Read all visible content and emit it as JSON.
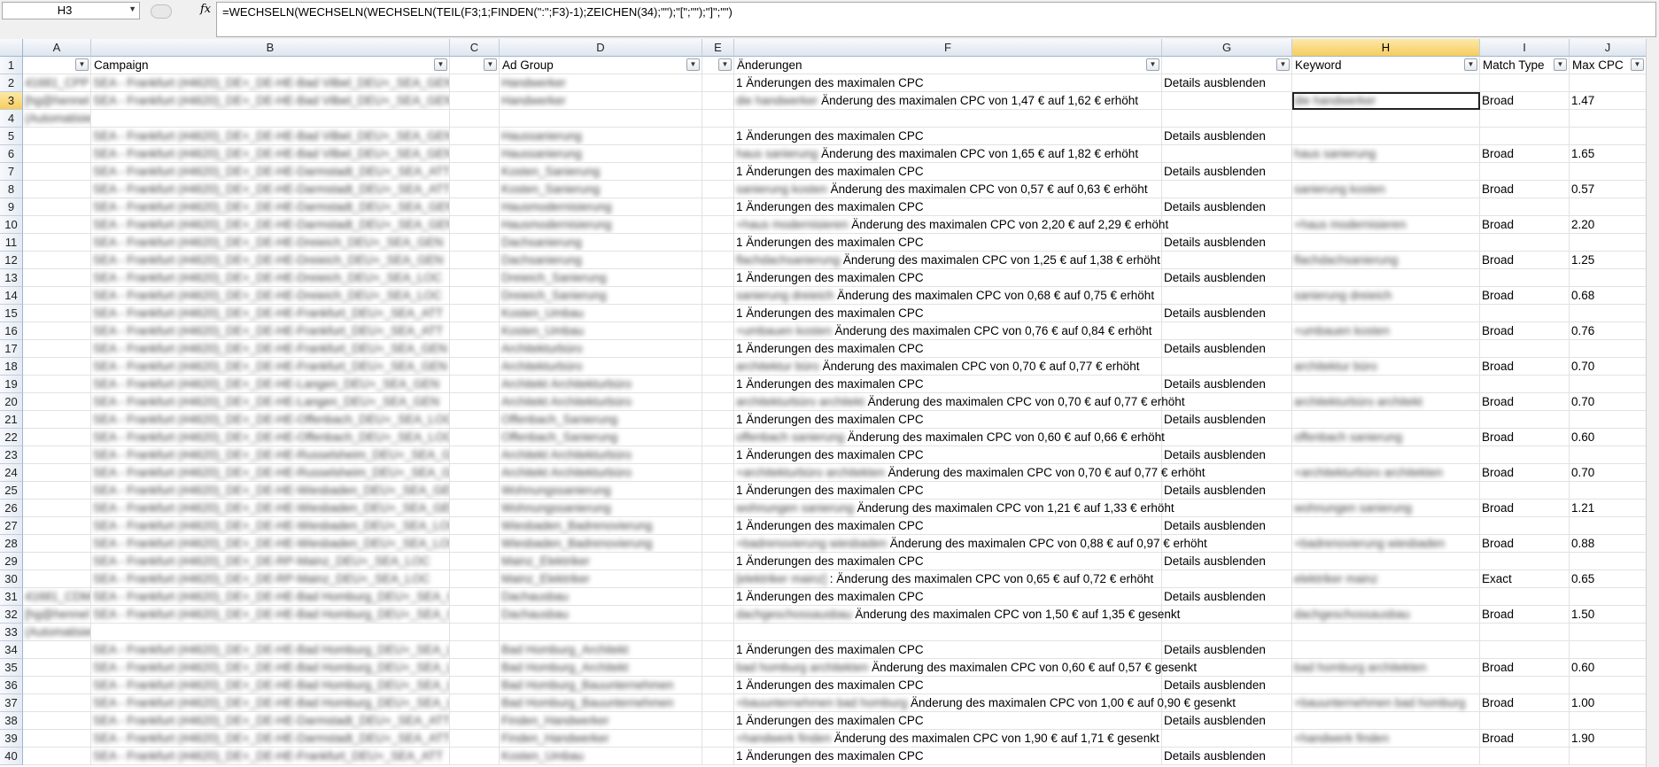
{
  "formula_bar": {
    "name_box": "H3",
    "fx": "fx",
    "formula": "=WECHSELN(WECHSELN(WECHSELN(TEIL(F3;1;FINDEN(\":\";F3)-1);ZEICHEN(34);\"\");\"[\";\"\");\"]\";\"\")"
  },
  "columns": [
    "A",
    "B",
    "C",
    "D",
    "E",
    "F",
    "G",
    "H",
    "I",
    "J"
  ],
  "headers": {
    "A": "",
    "B": "Campaign",
    "C": "",
    "D": "Ad Group",
    "E": "",
    "F": "Änderungen",
    "G": "",
    "H": "Keyword",
    "I": "Match Type",
    "J": "Max CPC"
  },
  "rows": [
    {
      "n": "2",
      "a": "41681_CPP",
      "b": "SEA - Frankfurt (#4620)_DE+_DE-HE-Bad Vilbel_DEU+_SEA_GEN",
      "d": "Handwerker",
      "f_pre": "",
      "f": "1 Änderungen des maximalen CPC",
      "g": "Details ausblenden",
      "h": "",
      "i": "",
      "j": ""
    },
    {
      "n": "3",
      "a": "[hg@hennel",
      "b": "SEA - Frankfurt (#4620)_DE+_DE-HE-Bad Vilbel_DEU+_SEA_GEN",
      "d": "Handwerker",
      "f_pre": "die handwerker",
      "f": "Änderung des maximalen CPC von 1,47 € auf 1,62 € erhöht",
      "g": "",
      "h": "die handwerker",
      "i": "Broad",
      "j": "1.47"
    },
    {
      "n": "4",
      "a": "(Automatisierung)",
      "b": "",
      "d": "",
      "f_pre": "",
      "f": "",
      "g": "",
      "h": "",
      "i": "",
      "j": ""
    },
    {
      "n": "5",
      "a": "",
      "b": "SEA - Frankfurt (#4620)_DE+_DE-HE-Bad Vilbel_DEU+_SEA_GEN",
      "d": "Haussanierung",
      "f_pre": "",
      "f": "1 Änderungen des maximalen CPC",
      "g": "Details ausblenden",
      "h": "",
      "i": "",
      "j": ""
    },
    {
      "n": "6",
      "a": "",
      "b": "SEA - Frankfurt (#4620)_DE+_DE-HE-Bad Vilbel_DEU+_SEA_GEN",
      "d": "Haussanierung",
      "f_pre": "haus sanierung",
      "f": "Änderung des maximalen CPC von 1,65 € auf 1,82 € erhöht",
      "g": "",
      "h": "haus sanierung",
      "i": "Broad",
      "j": "1.65"
    },
    {
      "n": "7",
      "a": "",
      "b": "SEA - Frankfurt (#4620)_DE+_DE-HE-Darmstadt_DEU+_SEA_ATT",
      "d": "Kosten_Sanierung",
      "f_pre": "",
      "f": "1 Änderungen des maximalen CPC",
      "g": "Details ausblenden",
      "h": "",
      "i": "",
      "j": ""
    },
    {
      "n": "8",
      "a": "",
      "b": "SEA - Frankfurt (#4620)_DE+_DE-HE-Darmstadt_DEU+_SEA_ATT",
      "d": "Kosten_Sanierung",
      "f_pre": "sanierung kosten",
      "f": "Änderung des maximalen CPC von 0,57 € auf 0,63 € erhöht",
      "g": "",
      "h": "sanierung kosten",
      "i": "Broad",
      "j": "0.57"
    },
    {
      "n": "9",
      "a": "",
      "b": "SEA - Frankfurt (#4620)_DE+_DE-HE-Darmstadt_DEU+_SEA_GEN",
      "d": "Hausmodernisierung",
      "f_pre": "",
      "f": "1 Änderungen des maximalen CPC",
      "g": "Details ausblenden",
      "h": "",
      "i": "",
      "j": ""
    },
    {
      "n": "10",
      "a": "",
      "b": "SEA - Frankfurt (#4620)_DE+_DE-HE-Darmstadt_DEU+_SEA_GEN",
      "d": "Hausmodernisierung",
      "f_pre": "+haus modernisieren",
      "f": "Änderung des maximalen CPC von 2,20 € auf 2,29 € erhöht",
      "g": "",
      "h": "+haus modernisieren",
      "i": "Broad",
      "j": "2.20"
    },
    {
      "n": "11",
      "a": "",
      "b": "SEA - Frankfurt (#4620)_DE+_DE-HE-Dreieich_DEU+_SEA_GEN",
      "d": "Dachsanierung",
      "f_pre": "",
      "f": "1 Änderungen des maximalen CPC",
      "g": "Details ausblenden",
      "h": "",
      "i": "",
      "j": ""
    },
    {
      "n": "12",
      "a": "",
      "b": "SEA - Frankfurt (#4620)_DE+_DE-HE-Dreieich_DEU+_SEA_GEN",
      "d": "Dachsanierung",
      "f_pre": "flachdachsanierung",
      "f": "Änderung des maximalen CPC von 1,25 € auf 1,38 € erhöht",
      "g": "",
      "h": "flachdachsanierung",
      "i": "Broad",
      "j": "1.25"
    },
    {
      "n": "13",
      "a": "",
      "b": "SEA - Frankfurt (#4620)_DE+_DE-HE-Dreieich_DEU+_SEA_LOC",
      "d": "Dreieich_Sanierung",
      "f_pre": "",
      "f": "1 Änderungen des maximalen CPC",
      "g": "Details ausblenden",
      "h": "",
      "i": "",
      "j": ""
    },
    {
      "n": "14",
      "a": "",
      "b": "SEA - Frankfurt (#4620)_DE+_DE-HE-Dreieich_DEU+_SEA_LOC",
      "d": "Dreieich_Sanierung",
      "f_pre": "sanierung dreieich",
      "f": "Änderung des maximalen CPC von 0,68 € auf 0,75 € erhöht",
      "g": "",
      "h": "sanierung dreieich",
      "i": "Broad",
      "j": "0.68"
    },
    {
      "n": "15",
      "a": "",
      "b": "SEA - Frankfurt (#4620)_DE+_DE-HE-Frankfurt_DEU+_SEA_ATT",
      "d": "Kosten_Umbau",
      "f_pre": "",
      "f": "1 Änderungen des maximalen CPC",
      "g": "Details ausblenden",
      "h": "",
      "i": "",
      "j": ""
    },
    {
      "n": "16",
      "a": "",
      "b": "SEA - Frankfurt (#4620)_DE+_DE-HE-Frankfurt_DEU+_SEA_ATT",
      "d": "Kosten_Umbau",
      "f_pre": "+umbauen kosten",
      "f": "Änderung des maximalen CPC von 0,76 € auf 0,84 € erhöht",
      "g": "",
      "h": "+umbauen kosten",
      "i": "Broad",
      "j": "0.76"
    },
    {
      "n": "17",
      "a": "",
      "b": "SEA - Frankfurt (#4620)_DE+_DE-HE-Frankfurt_DEU+_SEA_GEN",
      "d": "Architekturbüro",
      "f_pre": "",
      "f": "1 Änderungen des maximalen CPC",
      "g": "Details ausblenden",
      "h": "",
      "i": "",
      "j": ""
    },
    {
      "n": "18",
      "a": "",
      "b": "SEA - Frankfurt (#4620)_DE+_DE-HE-Frankfurt_DEU+_SEA_GEN",
      "d": "Architekturbüro",
      "f_pre": "architektur büro",
      "f": "Änderung des maximalen CPC von 0,70 € auf 0,77 € erhöht",
      "g": "",
      "h": "architektur büro",
      "i": "Broad",
      "j": "0.70"
    },
    {
      "n": "19",
      "a": "",
      "b": "SEA - Frankfurt (#4620)_DE+_DE-HE-Langen_DEU+_SEA_GEN",
      "d": "Architekt Architekturbüro",
      "f_pre": "",
      "f": "1 Änderungen des maximalen CPC",
      "g": "Details ausblenden",
      "h": "",
      "i": "",
      "j": ""
    },
    {
      "n": "20",
      "a": "",
      "b": "SEA - Frankfurt (#4620)_DE+_DE-HE-Langen_DEU+_SEA_GEN",
      "d": "Architekt Architekturbüro",
      "f_pre": "architekturbüro architekt",
      "f": "Änderung des maximalen CPC von 0,70 € auf 0,77 € erhöht",
      "g": "",
      "h": "architekturbüro architekt",
      "i": "Broad",
      "j": "0.70"
    },
    {
      "n": "21",
      "a": "",
      "b": "SEA - Frankfurt (#4620)_DE+_DE-HE-Offenbach_DEU+_SEA_LOC",
      "d": "Offenbach_Sanierung",
      "f_pre": "",
      "f": "1 Änderungen des maximalen CPC",
      "g": "Details ausblenden",
      "h": "",
      "i": "",
      "j": ""
    },
    {
      "n": "22",
      "a": "",
      "b": "SEA - Frankfurt (#4620)_DE+_DE-HE-Offenbach_DEU+_SEA_LOC",
      "d": "Offenbach_Sanierung",
      "f_pre": "offenbach sanierung",
      "f": "Änderung des maximalen CPC von 0,60 € auf 0,66 € erhöht",
      "g": "",
      "h": "offenbach sanierung",
      "i": "Broad",
      "j": "0.60"
    },
    {
      "n": "23",
      "a": "",
      "b": "SEA - Frankfurt (#4620)_DE+_DE-HE-Russelsheim_DEU+_SEA_GEN",
      "d": "Architekt Architekturbüro",
      "f_pre": "",
      "f": "1 Änderungen des maximalen CPC",
      "g": "Details ausblenden",
      "h": "",
      "i": "",
      "j": ""
    },
    {
      "n": "24",
      "a": "",
      "b": "SEA - Frankfurt (#4620)_DE+_DE-HE-Russelsheim_DEU+_SEA_GEN",
      "d": "Architekt Architekturbüro",
      "f_pre": "+architekturbüro architekten",
      "f": "Änderung des maximalen CPC von 0,70 € auf 0,77 € erhöht",
      "g": "",
      "h": "+architekturbüro architekten",
      "i": "Broad",
      "j": "0.70"
    },
    {
      "n": "25",
      "a": "",
      "b": "SEA - Frankfurt (#4620)_DE+_DE-HE-Wiesbaden_DEU+_SEA_GEN",
      "d": "Wohnungssanierung",
      "f_pre": "",
      "f": "1 Änderungen des maximalen CPC",
      "g": "Details ausblenden",
      "h": "",
      "i": "",
      "j": ""
    },
    {
      "n": "26",
      "a": "",
      "b": "SEA - Frankfurt (#4620)_DE+_DE-HE-Wiesbaden_DEU+_SEA_GEN",
      "d": "Wohnungssanierung",
      "f_pre": "wohnungen sanierung",
      "f": "Änderung des maximalen CPC von 1,21 € auf 1,33 € erhöht",
      "g": "",
      "h": "wohnungen sanierung",
      "i": "Broad",
      "j": "1.21"
    },
    {
      "n": "27",
      "a": "",
      "b": "SEA - Frankfurt (#4620)_DE+_DE-HE-Wiesbaden_DEU+_SEA_LOC",
      "d": "Wiesbaden_Badrenovierung",
      "f_pre": "",
      "f": "1 Änderungen des maximalen CPC",
      "g": "Details ausblenden",
      "h": "",
      "i": "",
      "j": ""
    },
    {
      "n": "28",
      "a": "",
      "b": "SEA - Frankfurt (#4620)_DE+_DE-HE-Wiesbaden_DEU+_SEA_LOC",
      "d": "Wiesbaden_Badrenovierung",
      "f_pre": "+badrenovierung wiesbaden",
      "f": "Änderung des maximalen CPC von 0,88 € auf 0,97 € erhöht",
      "g": "",
      "h": "+badrenovierung wiesbaden",
      "i": "Broad",
      "j": "0.88"
    },
    {
      "n": "29",
      "a": "",
      "b": "SEA - Frankfurt (#4620)_DE+_DE-RP-Mainz_DEU+_SEA_LOC",
      "d": "Mainz_Elektriker",
      "f_pre": "",
      "f": "1 Änderungen des maximalen CPC",
      "g": "Details ausblenden",
      "h": "",
      "i": "",
      "j": ""
    },
    {
      "n": "30",
      "a": "",
      "b": "SEA - Frankfurt (#4620)_DE+_DE-RP-Mainz_DEU+_SEA_LOC",
      "d": "Mainz_Elektriker",
      "f_pre": "[elektriker mainz]",
      "f": ": Änderung des maximalen CPC von 0,65 € auf 0,72 € erhöht",
      "g": "",
      "h": "elektriker mainz",
      "i": "Exact",
      "j": "0.65"
    },
    {
      "n": "31",
      "a": "41681_CDM",
      "b": "SEA - Frankfurt (#4620)_DE+_DE-HE-Bad Homburg_DEU+_SEA_GEN",
      "d": "Dachausbau",
      "f_pre": "",
      "f": "1 Änderungen des maximalen CPC",
      "g": "Details ausblenden",
      "h": "",
      "i": "",
      "j": ""
    },
    {
      "n": "32",
      "a": "[hg@hennel",
      "b": "SEA - Frankfurt (#4620)_DE+_DE-HE-Bad Homburg_DEU+_SEA_GEN",
      "d": "Dachausbau",
      "f_pre": "dachgeschossausbau",
      "f": "Änderung des maximalen CPC von 1,50 € auf 1,35 € gesenkt",
      "g": "",
      "h": "dachgeschossausbau",
      "i": "Broad",
      "j": "1.50"
    },
    {
      "n": "33",
      "a": "(Automatisierung)",
      "b": "",
      "d": "",
      "f_pre": "",
      "f": "",
      "g": "",
      "h": "",
      "i": "",
      "j": ""
    },
    {
      "n": "34",
      "a": "",
      "b": "SEA - Frankfurt (#4620)_DE+_DE-HE-Bad Homburg_DEU+_SEA_LOC",
      "d": "Bad Homburg_Architekt",
      "f_pre": "",
      "f": "1 Änderungen des maximalen CPC",
      "g": "Details ausblenden",
      "h": "",
      "i": "",
      "j": ""
    },
    {
      "n": "35",
      "a": "",
      "b": "SEA - Frankfurt (#4620)_DE+_DE-HE-Bad Homburg_DEU+_SEA_LOC",
      "d": "Bad Homburg_Architekt",
      "f_pre": "bad homburg architekten",
      "f": "Änderung des maximalen CPC von 0,60 € auf 0,57 € gesenkt",
      "g": "",
      "h": "bad homburg architekten",
      "i": "Broad",
      "j": "0.60"
    },
    {
      "n": "36",
      "a": "",
      "b": "SEA - Frankfurt (#4620)_DE+_DE-HE-Bad Homburg_DEU+_SEA_LOC",
      "d": "Bad Homburg_Bauunternehmen",
      "f_pre": "",
      "f": "1 Änderungen des maximalen CPC",
      "g": "Details ausblenden",
      "h": "",
      "i": "",
      "j": ""
    },
    {
      "n": "37",
      "a": "",
      "b": "SEA - Frankfurt (#4620)_DE+_DE-HE-Bad Homburg_DEU+_SEA_LOC",
      "d": "Bad Homburg_Bauunternehmen",
      "f_pre": "+bauunternehmen bad homburg",
      "f": "Änderung des maximalen CPC von 1,00 € auf 0,90 € gesenkt",
      "g": "",
      "h": "+bauunternehmen bad homburg",
      "i": "Broad",
      "j": "1.00"
    },
    {
      "n": "38",
      "a": "",
      "b": "SEA - Frankfurt (#4620)_DE+_DE-HE-Darmstadt_DEU+_SEA_ATT",
      "d": "Finden_Handwerker",
      "f_pre": "",
      "f": "1 Änderungen des maximalen CPC",
      "g": "Details ausblenden",
      "h": "",
      "i": "",
      "j": ""
    },
    {
      "n": "39",
      "a": "",
      "b": "SEA - Frankfurt (#4620)_DE+_DE-HE-Darmstadt_DEU+_SEA_ATT",
      "d": "Finden_Handwerker",
      "f_pre": "+handwerk finden",
      "f": "Änderung des maximalen CPC von 1,90 € auf 1,71 € gesenkt",
      "g": "",
      "h": "+handwerk finden",
      "i": "Broad",
      "j": "1.90"
    },
    {
      "n": "40",
      "a": "",
      "b": "SEA - Frankfurt (#4620)_DE+_DE-HE-Frankfurt_DEU+_SEA_ATT",
      "d": "Kosten_Umbau",
      "f_pre": "",
      "f": "1 Änderungen des maximalen CPC",
      "g": "Details ausblenden",
      "h": "",
      "i": "",
      "j": ""
    }
  ],
  "selection": {
    "cell": "H3",
    "column": "H",
    "row": "3"
  }
}
